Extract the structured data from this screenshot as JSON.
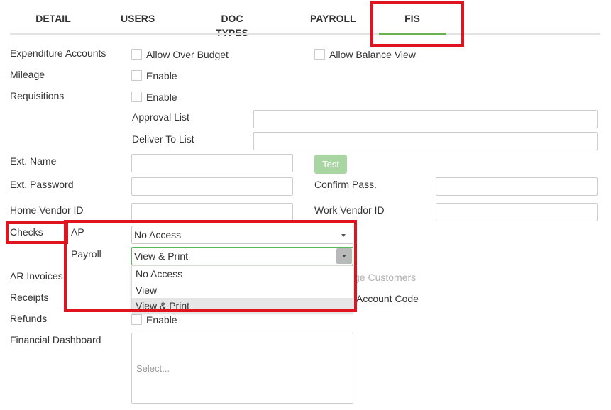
{
  "tabs": [
    {
      "label": "DETAIL"
    },
    {
      "label": "USERS"
    },
    {
      "label": "DOC TYPES"
    },
    {
      "label": "PAYROLL"
    },
    {
      "label": "FIS"
    }
  ],
  "active_tab": "FIS",
  "form": {
    "expenditure_accounts": {
      "label": "Expenditure Accounts",
      "allow_over_budget": "Allow Over Budget",
      "allow_balance_view": "Allow Balance View"
    },
    "mileage": {
      "label": "Mileage",
      "enable": "Enable"
    },
    "requisitions": {
      "label": "Requisitions",
      "enable": "Enable",
      "approval_list_label": "Approval List",
      "deliver_to_list_label": "Deliver To List"
    },
    "ext_name": {
      "label": "Ext. Name",
      "test_button": "Test"
    },
    "ext_password": {
      "label": "Ext. Password",
      "confirm_label": "Confirm Pass."
    },
    "home_vendor_id": {
      "label": "Home Vendor ID",
      "work_vendor_label": "Work Vendor ID"
    },
    "checks": {
      "label": "Checks",
      "ap_label": "AP",
      "ap_value": "No Access",
      "payroll_label": "Payroll",
      "payroll_value": "View & Print",
      "options": [
        "No Access",
        "View",
        "View & Print"
      ]
    },
    "ar_invoices": {
      "label": "AR Invoices",
      "partial_text": "ge Customers"
    },
    "receipts": {
      "label": "Receipts",
      "partial_text": "Account Code"
    },
    "refunds": {
      "label": "Refunds",
      "enable": "Enable"
    },
    "financial_dashboard": {
      "label": "Financial Dashboard",
      "placeholder": "Select..."
    }
  },
  "colors": {
    "accent_green": "#6ab04c",
    "highlight_red": "#e0141e",
    "test_button": "#a8d5a2"
  }
}
